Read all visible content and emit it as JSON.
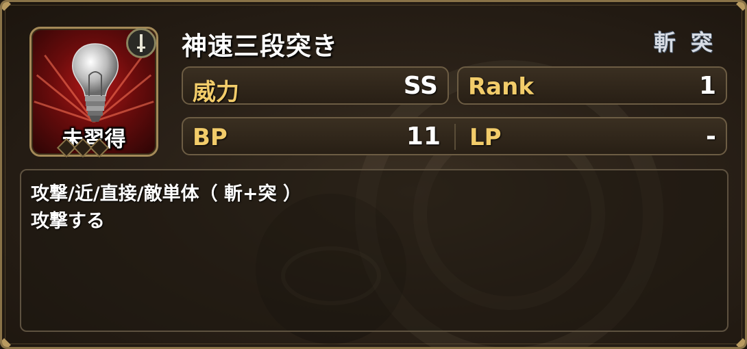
{
  "skill": {
    "name": "神速三段突き",
    "status_label": "未習得",
    "icon": "light-bulb-icon",
    "weapon_icon": "sword-icon",
    "attributes": [
      "斬",
      "突"
    ],
    "sub_slots": 3
  },
  "stats": {
    "power": {
      "label": "威力",
      "value": "SS"
    },
    "rank": {
      "label": "Rank",
      "value": "1"
    },
    "bp": {
      "label": "BP",
      "value": "11"
    },
    "lp": {
      "label": "LP",
      "value": "-"
    }
  },
  "description": {
    "line1": "攻撃/近/直接/敵単体（ 斬+突 ）",
    "line2": "攻撃する"
  },
  "colors": {
    "accent_gold": "#f2cc6a",
    "frame_gold": "#8a7348",
    "icon_red": "#b01818"
  }
}
